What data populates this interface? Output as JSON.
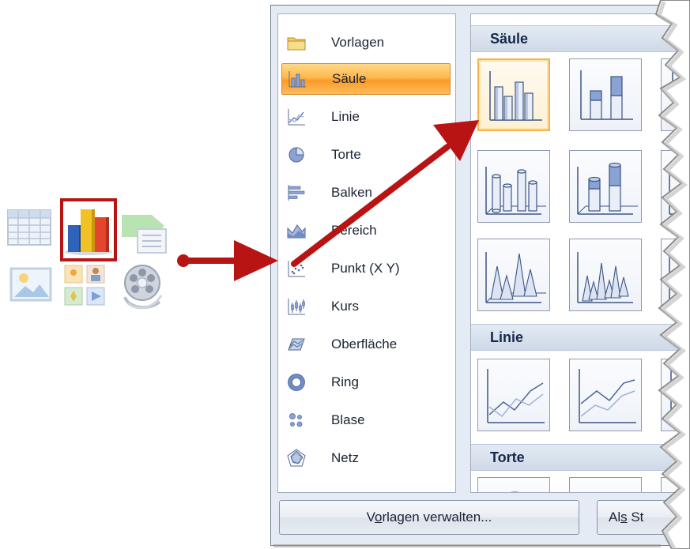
{
  "chart_types": [
    {
      "label": "Vorlagen",
      "icon": "folder-icon"
    },
    {
      "label": "Säule",
      "icon": "column-chart-icon",
      "selected": true
    },
    {
      "label": "Linie",
      "icon": "line-chart-icon"
    },
    {
      "label": "Torte",
      "icon": "pie-chart-icon"
    },
    {
      "label": "Balken",
      "icon": "bar-chart-icon"
    },
    {
      "label": "Bereich",
      "icon": "area-chart-icon"
    },
    {
      "label": "Punkt (X Y)",
      "icon": "scatter-chart-icon"
    },
    {
      "label": "Kurs",
      "icon": "stock-chart-icon"
    },
    {
      "label": "Oberfläche",
      "icon": "surface-chart-icon"
    },
    {
      "label": "Ring",
      "icon": "doughnut-chart-icon"
    },
    {
      "label": "Blase",
      "icon": "bubble-chart-icon"
    },
    {
      "label": "Netz",
      "icon": "radar-chart-icon"
    }
  ],
  "gallery": {
    "sections": [
      "Säule",
      "Linie",
      "Torte"
    ]
  },
  "buttons": {
    "manage_templates_pre": "V",
    "manage_templates_ul": "o",
    "manage_templates_post": "rlagen verwalten...",
    "set_default_pre": "Al",
    "set_default_ul": "s",
    "set_default_post": " St"
  },
  "colors": {
    "highlight_border": "#b81414",
    "arrow": "#b81414",
    "selection_orange": "#fb9b2a",
    "chart_blue": "#7f96c4"
  }
}
